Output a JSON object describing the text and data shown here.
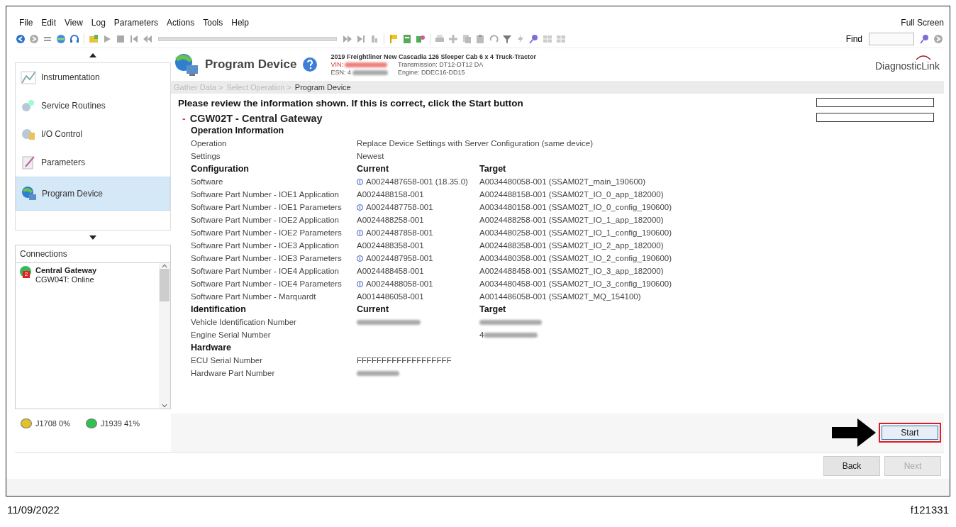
{
  "menu": [
    "File",
    "Edit",
    "View",
    "Log",
    "Parameters",
    "Actions",
    "Tools",
    "Help"
  ],
  "full_screen": "Full Screen",
  "find": {
    "label": "Find"
  },
  "header": {
    "title": "Program Device",
    "vehicle": "2019 Freightliner New Cascadia 126 Sleeper Cab 6 x 4 Truck-Tractor",
    "vin_label": "VIN:",
    "esn_label": "ESN: 4",
    "transmission": "Transmission: DT12-DT12 DA",
    "engine": "Engine: DDEC16-DD15",
    "brand": "DiagnosticLink"
  },
  "breadcrumb": [
    {
      "label": "Gather Data >",
      "selected": false
    },
    {
      "label": "Select Operation >",
      "selected": false
    },
    {
      "label": "Program Device",
      "selected": true
    }
  ],
  "sidebar": {
    "items": [
      {
        "label": "Instrumentation",
        "selected": false
      },
      {
        "label": "Service Routines",
        "selected": false
      },
      {
        "label": "I/O Control",
        "selected": false
      },
      {
        "label": "Parameters",
        "selected": false
      },
      {
        "label": "Program Device",
        "selected": true
      }
    ]
  },
  "connections": {
    "title": "Connections",
    "items": [
      {
        "name": "Central Gateway",
        "status": "CGW04T: Online",
        "badge": "2"
      }
    ]
  },
  "bus_status": [
    {
      "label": "J1708 0%",
      "color": "#e2c22a"
    },
    {
      "label": "J1939 41%",
      "color": "#2fc24e"
    }
  ],
  "instruction": "Please review the information shown. If this is correct, click the Start button",
  "device": {
    "toggle": "-",
    "title": "CGW02T - Central Gateway",
    "expanded": true
  },
  "sections": [
    {
      "title": "Operation Information",
      "rows": [
        {
          "label": "Operation",
          "current": "Replace Device Settings with Server Configuration (same device)"
        },
        {
          "label": "Settings",
          "current": "Newest"
        }
      ]
    },
    {
      "title": "Configuration",
      "current_header": "Current",
      "target_header": "Target",
      "rows": [
        {
          "label": "Software",
          "current": "A0024487658-001 (18.35.0)",
          "target": "A0034480058-001 (SSAM02T_main_190600)",
          "flagged": true
        },
        {
          "label": "Software Part Number - IOE1 Application",
          "current": "A0024488158-001",
          "target": "A0024488158-001 (SSAM02T_IO_0_app_182000)",
          "flagged": false
        },
        {
          "label": "Software Part Number - IOE1 Parameters",
          "current": "A0024487758-001",
          "target": "A0034480158-001 (SSAM02T_IO_0_config_190600)",
          "flagged": true
        },
        {
          "label": "Software Part Number - IOE2 Application",
          "current": "A0024488258-001",
          "target": "A0024488258-001 (SSAM02T_IO_1_app_182000)",
          "flagged": false
        },
        {
          "label": "Software Part Number - IOE2 Parameters",
          "current": "A0024487858-001",
          "target": "A0034480258-001 (SSAM02T_IO_1_config_190600)",
          "flagged": true
        },
        {
          "label": "Software Part Number - IOE3 Application",
          "current": "A0024488358-001",
          "target": "A0024488358-001 (SSAM02T_IO_2_app_182000)",
          "flagged": false
        },
        {
          "label": "Software Part Number - IOE3 Parameters",
          "current": "A0024487958-001",
          "target": "A0034480358-001 (SSAM02T_IO_2_config_190600)",
          "flagged": true
        },
        {
          "label": "Software Part Number - IOE4 Application",
          "current": "A0024488458-001",
          "target": "A0024488458-001 (SSAM02T_IO_3_app_182000)",
          "flagged": false
        },
        {
          "label": "Software Part Number - IOE4 Parameters",
          "current": "A0024488058-001",
          "target": "A0034480458-001 (SSAM02T_IO_3_config_190600)",
          "flagged": true
        },
        {
          "label": "Software Part Number - Marquardt",
          "current": "A0014486058-001",
          "target": "A0014486058-001 (SSAM02T_MQ_154100)",
          "flagged": false
        }
      ]
    },
    {
      "title": "Identification",
      "current_header": "Current",
      "target_header": "Target",
      "rows": [
        {
          "label": "Vehicle Identification Number",
          "current_blurred": true,
          "target_blurred": true
        },
        {
          "label": "Engine Serial Number",
          "target": "4",
          "target_blurred": true
        }
      ]
    },
    {
      "title": "Hardware",
      "rows": [
        {
          "label": "ECU Serial Number",
          "current": "FFFFFFFFFFFFFFFFFFF"
        },
        {
          "label": "Hardware Part Number",
          "current_blurred": true
        }
      ]
    }
  ],
  "buttons": {
    "start": "Start",
    "back": "Back",
    "next": {
      "label": "Next",
      "disabled": true
    }
  },
  "footer": {
    "date": "11/09/2022",
    "figure": "f121331"
  }
}
